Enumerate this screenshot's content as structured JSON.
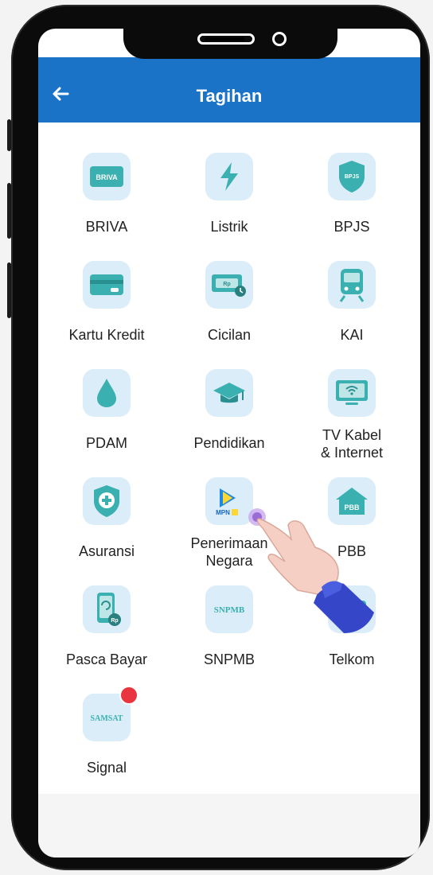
{
  "header": {
    "title": "Tagihan"
  },
  "items": [
    {
      "label": "BRIVA",
      "icon": "briva-card-icon",
      "badge_text": "BRIVA"
    },
    {
      "label": "Listrik",
      "icon": "lightning-icon"
    },
    {
      "label": "BPJS",
      "icon": "bpjs-shield-icon",
      "badge_text": "BPJS"
    },
    {
      "label": "Kartu Kredit",
      "icon": "credit-card-icon"
    },
    {
      "label": "Cicilan",
      "icon": "money-bill-icon",
      "badge_text": "Rp"
    },
    {
      "label": "KAI",
      "icon": "train-icon"
    },
    {
      "label": "PDAM",
      "icon": "water-drop-icon"
    },
    {
      "label": "Pendidikan",
      "icon": "graduation-cap-icon"
    },
    {
      "label": "TV Kabel\n& Internet",
      "label_line1": "TV Kabel",
      "label_line2": "& Internet",
      "icon": "tv-wifi-icon"
    },
    {
      "label": "Asuransi",
      "icon": "shield-plus-icon"
    },
    {
      "label_line1": "Penerimaan",
      "label_line2": "Negara",
      "icon": "mpn-icon",
      "badge_text": "MPN"
    },
    {
      "label": "PBB",
      "icon": "house-icon",
      "badge_text": "PBB"
    },
    {
      "label": "Pasca Bayar",
      "icon": "phone-refresh-icon",
      "badge_text": "Rp"
    },
    {
      "label": "SNPMB",
      "icon": "snpmb-icon",
      "badge_text": "SNPMB"
    },
    {
      "label": "Telkom",
      "icon": "telkom-icon"
    },
    {
      "label": "Signal",
      "icon": "samsat-icon",
      "badge_text": "SAMSAT"
    }
  ],
  "colors": {
    "header": "#1a73c7",
    "icon_bg": "#dcedfa",
    "icon_fg": "#3ab0b0",
    "badge": "#e8353f"
  }
}
